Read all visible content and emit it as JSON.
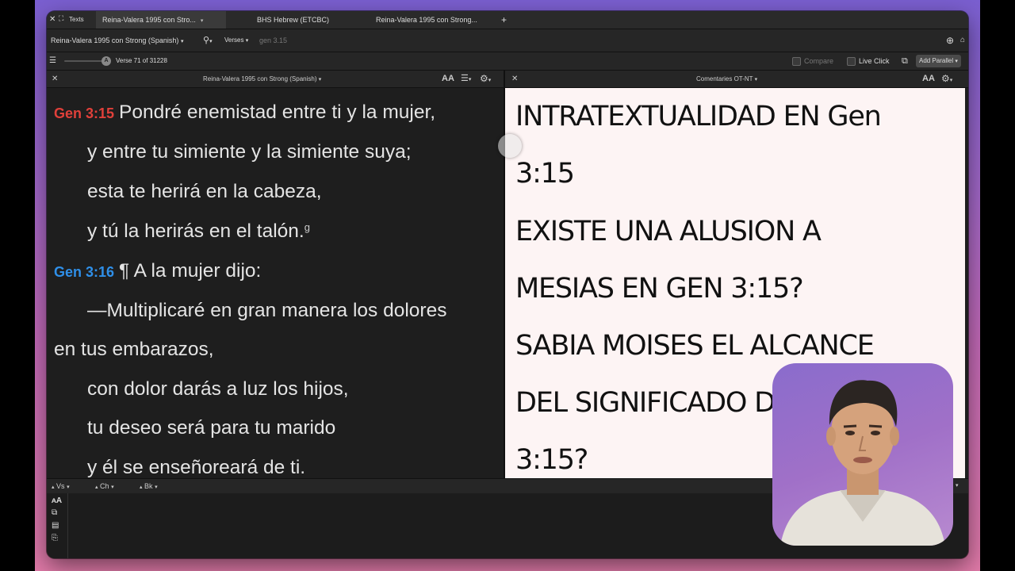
{
  "tabs": [
    {
      "label": "Reina-Valera 1995 con Stro...",
      "active": true
    },
    {
      "label": "BHS Hebrew (ETCBC)",
      "active": false
    },
    {
      "label": "Reina-Valera 1995 con Strong...",
      "active": false
    }
  ],
  "tabbar": {
    "texts_label": "Texts",
    "add_tab": "+"
  },
  "toolbar": {
    "resource": "Reina-Valera 1995 con Strong (Spanish)",
    "search_mode": "Verses",
    "reference_value": "gen 3.15"
  },
  "toolbar2": {
    "slider_knob": "A",
    "verse_position": "Verse 71 of 31228",
    "compare_label": "Compare",
    "live_click_label": "Live Click",
    "add_parallel_label": "Add Parallel"
  },
  "left_pane": {
    "title": "Reina-Valera 1995 con Strong (Spanish)",
    "font_icon": "AA",
    "lines": [
      {
        "ref": "Gen 3:15",
        "ref_color": "#e0403a",
        "text": "Pondré enemistad entre ti y la mujer,"
      },
      {
        "text": "y entre tu simiente y la simiente suya;"
      },
      {
        "text": "esta te herirá en la cabeza,"
      },
      {
        "text": "y tú la herirás en el talón.",
        "sup": "g"
      },
      {
        "ref": "Gen 3:16",
        "ref_color": "#2f8fe8",
        "text": "¶ A la mujer dijo:"
      },
      {
        "text": "—Multiplicaré en gran manera los dolores"
      },
      {
        "text": "en tus embarazos,"
      },
      {
        "text": "con dolor darás a luz los hijos,"
      },
      {
        "text": "tu deseo será para tu marido"
      },
      {
        "text": "y él se enseñoreará de ti."
      }
    ]
  },
  "right_pane": {
    "title": "Comentaries OT-NT",
    "font_icon": "AA",
    "lines": [
      "INTRATEXTUALIDAD EN Gen",
      "3:15",
      "EXISTE UNA ALUSION A",
      "MESIAS EN GEN 3:15?",
      "SABIA MOISES EL ALCANCE",
      "DEL SIGNIFICADO DE",
      "3:15?"
    ]
  },
  "nav": {
    "verse": "Vs",
    "chapter": "Ch",
    "book": "Bk"
  },
  "colors": {
    "accent_red": "#e0403a",
    "accent_blue": "#2f8fe8",
    "commentary_bg": "#fdf4f4"
  }
}
